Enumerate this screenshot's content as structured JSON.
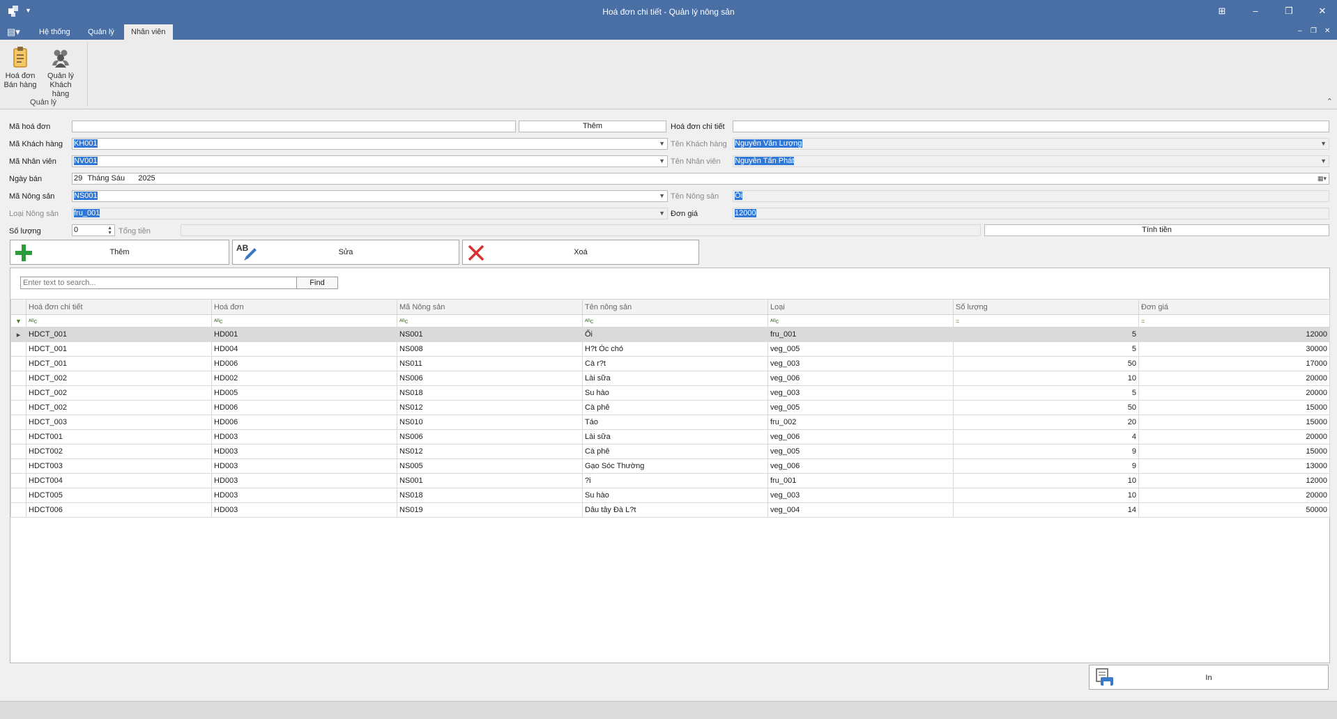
{
  "window": {
    "title": "Hoá đơn chi tiết - Quản lý nông sản"
  },
  "tabs": [
    "Hệ thống",
    "Quản lý",
    "Nhân viên"
  ],
  "ribbon": {
    "buttons": [
      {
        "label1": "Hoá đơn",
        "label2": "Bán hàng",
        "icon": "clipboard-icon"
      },
      {
        "label1": "Quản lý",
        "label2": "Khách hàng",
        "icon": "users-icon"
      }
    ],
    "group_label": "Quản lý"
  },
  "form": {
    "ma_hoa_don": {
      "label": "Mã hoá đơn",
      "value": ""
    },
    "them_small": "Thêm",
    "hoa_don_chi_tiet": {
      "label": "Hoá đơn chi tiết",
      "value": ""
    },
    "ma_khach_hang": {
      "label": "Mã Khách hàng",
      "value": "KH001"
    },
    "ten_khach_hang": {
      "label": "Tên Khách hàng",
      "value": "Nguyễn Văn Lượng"
    },
    "ma_nhan_vien": {
      "label": "Mã Nhân viên",
      "value": "NV001"
    },
    "ten_nhan_vien": {
      "label": "Tên Nhân viên",
      "value": "Nguyễn Tấn Phát"
    },
    "ngay_ban": {
      "label": "Ngày bán",
      "day": "29",
      "month": "Tháng Sáu",
      "year": "2025"
    },
    "ma_nong_san": {
      "label": "Mã Nông sản",
      "value": "NS001"
    },
    "ten_nong_san": {
      "label": "Tên Nông sản",
      "value": "Ổi"
    },
    "loai_nong_san": {
      "label": "Loại Nông sản",
      "value": "fru_001"
    },
    "don_gia": {
      "label": "Đơn giá",
      "value": "12000"
    },
    "so_luong": {
      "label": "Số lượng",
      "value": "0"
    },
    "tong_tien": {
      "label": "Tổng tiền",
      "value": ""
    },
    "tinh_tien": "Tính tiền"
  },
  "actions": {
    "them": "Thêm",
    "sua": "Sửa",
    "xoa": "Xoá",
    "sua_icon_text": "AB"
  },
  "search": {
    "placeholder": "Enter text to search...",
    "find": "Find"
  },
  "grid": {
    "columns": [
      "Hoá đơn chi tiết",
      "Hoá đơn",
      "Mã Nông sản",
      "Tên nông sản",
      "Loại",
      "Số lượng",
      "Đơn giá"
    ],
    "filter_text": "ᴬᴮc",
    "filter_num": "=",
    "rows": [
      [
        "HDCT_001",
        "HD001",
        "NS001",
        "Ổi",
        "fru_001",
        "5",
        "12000"
      ],
      [
        "HDCT_001",
        "HD004",
        "NS008",
        "H?t Óc chó",
        "veg_005",
        "5",
        "30000"
      ],
      [
        "HDCT_001",
        "HD006",
        "NS011",
        "Cà r?t",
        "veg_003",
        "50",
        "17000"
      ],
      [
        "HDCT_002",
        "HD002",
        "NS006",
        "Lài sữa",
        "veg_006",
        "10",
        "20000"
      ],
      [
        "HDCT_002",
        "HD005",
        "NS018",
        "Su hào",
        "veg_003",
        "5",
        "20000"
      ],
      [
        "HDCT_002",
        "HD006",
        "NS012",
        "Cà phê",
        "veg_005",
        "50",
        "15000"
      ],
      [
        "HDCT_003",
        "HD006",
        "NS010",
        "Táo",
        "fru_002",
        "20",
        "15000"
      ],
      [
        "HDCT001",
        "HD003",
        "NS006",
        "Lài sữa",
        "veg_006",
        "4",
        "20000"
      ],
      [
        "HDCT002",
        "HD003",
        "NS012",
        "Cà phê",
        "veg_005",
        "9",
        "15000"
      ],
      [
        "HDCT003",
        "HD003",
        "NS005",
        "Gạo Sóc Thường",
        "veg_006",
        "9",
        "13000"
      ],
      [
        "HDCT004",
        "HD003",
        "NS001",
        "?i",
        "fru_001",
        "10",
        "12000"
      ],
      [
        "HDCT005",
        "HD003",
        "NS018",
        "Su hào",
        "veg_003",
        "10",
        "20000"
      ],
      [
        "HDCT006",
        "HD003",
        "NS019",
        "Dâu tây Đà L?t",
        "veg_004",
        "14",
        "50000"
      ]
    ]
  },
  "print": "In"
}
